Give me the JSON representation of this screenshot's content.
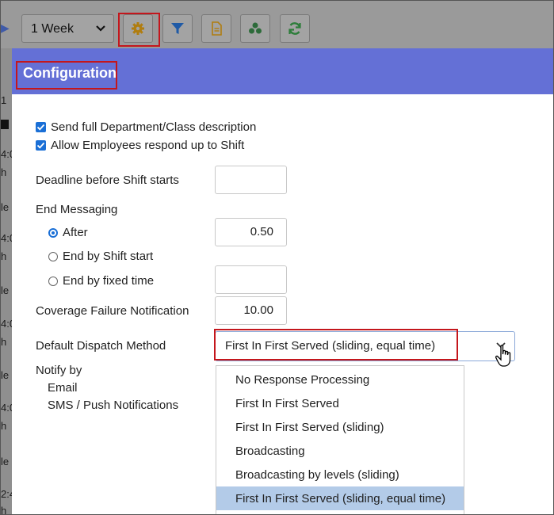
{
  "toolbar": {
    "period_select": "1 Week",
    "buttons": [
      "gear-icon",
      "filter-icon",
      "document-icon",
      "group-icon",
      "refresh-icon"
    ]
  },
  "background": {
    "fragments": [
      "1",
      "4:0",
      "h",
      "le",
      "4:0",
      "h",
      "le",
      "4:0",
      "h",
      "le",
      "4:0",
      "h",
      "le",
      "2:4",
      "h"
    ]
  },
  "dialog": {
    "title": "Configuration",
    "checkboxes": [
      {
        "label": "Send full Department/Class description",
        "checked": true
      },
      {
        "label": "Allow Employees respond up to Shift",
        "checked": true
      }
    ],
    "deadline": {
      "label": "Deadline before Shift starts",
      "value": ""
    },
    "end_messaging": {
      "label": "End Messaging",
      "options": [
        {
          "label": "After",
          "selected": true,
          "value": "0.50"
        },
        {
          "label": "End by Shift start",
          "selected": false
        },
        {
          "label": "End by fixed time",
          "selected": false,
          "value": ""
        }
      ]
    },
    "coverage": {
      "label": "Coverage Failure Notification",
      "value": "10.00"
    },
    "dispatch": {
      "label": "Default Dispatch Method",
      "value": "First In First Served (sliding, equal time)",
      "options": [
        "No Response Processing",
        "First In First Served",
        "First In First Served (sliding)",
        "Broadcasting",
        "Broadcasting by levels (sliding)",
        "First In First Served (sliding, equal time)"
      ]
    },
    "notify": {
      "label": "Notify by",
      "email": "Email",
      "sms": "SMS / Push Notifications"
    }
  },
  "colors": {
    "header": "#6470d6",
    "accent": "#1a6fd6",
    "highlight_border": "#c4161c",
    "selected_option": "#b3cbe8"
  }
}
